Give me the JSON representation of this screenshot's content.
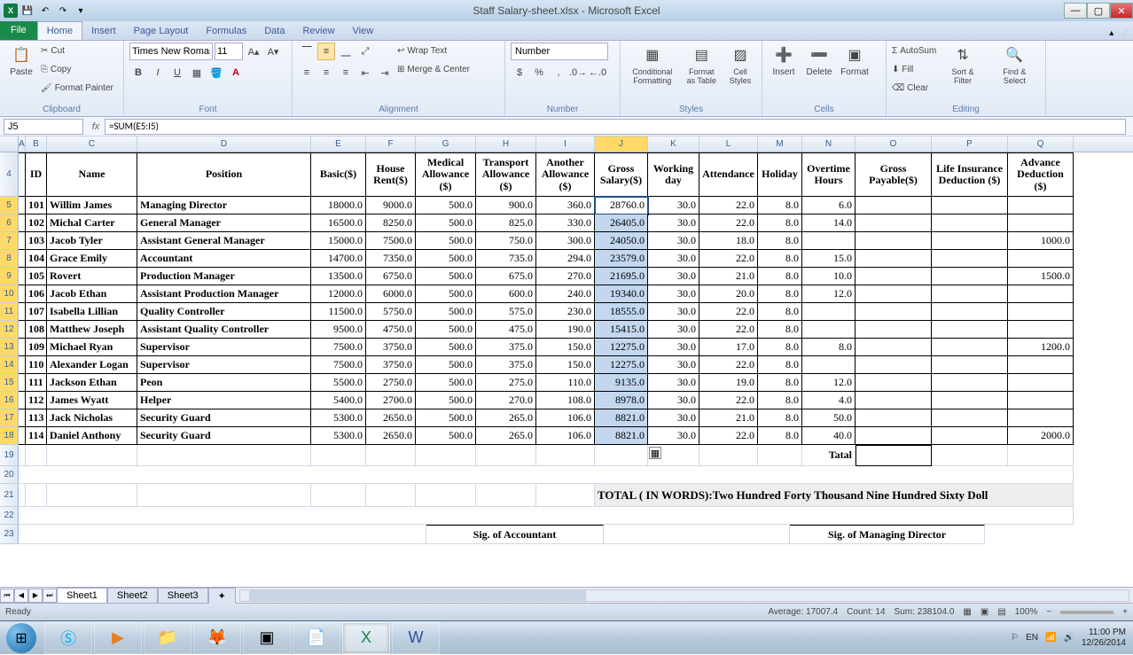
{
  "title_bar": {
    "title": "Staff  Salary-sheet.xlsx - Microsoft Excel"
  },
  "tabs": {
    "file": "File",
    "items": [
      "Home",
      "Insert",
      "Page Layout",
      "Formulas",
      "Data",
      "Review",
      "View"
    ],
    "active": "Home"
  },
  "ribbon": {
    "clipboard": {
      "label": "Clipboard",
      "paste": "Paste",
      "cut": "Cut",
      "copy": "Copy",
      "format_painter": "Format Painter"
    },
    "font": {
      "label": "Font",
      "name": "Times New Roman",
      "size": "11"
    },
    "alignment": {
      "label": "Alignment",
      "wrap": "Wrap Text",
      "merge": "Merge & Center"
    },
    "number": {
      "label": "Number",
      "format": "Number"
    },
    "styles": {
      "label": "Styles",
      "cond": "Conditional Formatting",
      "table": "Format as Table",
      "cell": "Cell Styles"
    },
    "cells": {
      "label": "Cells",
      "insert": "Insert",
      "delete": "Delete",
      "format": "Format"
    },
    "editing": {
      "label": "Editing",
      "autosum": "AutoSum",
      "fill": "Fill",
      "clear": "Clear",
      "sort": "Sort & Filter",
      "find": "Find & Select"
    }
  },
  "namebox": "J5",
  "formula": "=SUM(E5:I5)",
  "chart_data": {
    "type": "table",
    "columns": [
      "A",
      "B",
      "C",
      "D",
      "E",
      "F",
      "G",
      "H",
      "I",
      "J",
      "K",
      "L",
      "M",
      "N",
      "O",
      "P",
      "Q"
    ],
    "headers": [
      "",
      "ID",
      "Name",
      "Position",
      "Basic($)",
      "House Rent($)",
      "Medical Allowance ($)",
      "Transport Allowance ($)",
      "Another Allowance ($)",
      "Gross Salary($)",
      "Working day",
      "Attendance",
      "Holiday",
      "Overtime Hours",
      "Gross Payable($)",
      "Life Insurance Deduction ($)",
      "Advance Deduction ($)"
    ],
    "rows": [
      {
        "r": 5,
        "id": "101",
        "name": "Willim James",
        "pos": "Managing Director",
        "basic": "18000.0",
        "rent": "9000.0",
        "med": "500.0",
        "trn": "900.0",
        "ano": "360.0",
        "gross": "28760.0",
        "wd": "30.0",
        "att": "22.0",
        "hol": "8.0",
        "ot": "6.0",
        "gp": "",
        "life": "",
        "adv": ""
      },
      {
        "r": 6,
        "id": "102",
        "name": "Michal Carter",
        "pos": "General Manager",
        "basic": "16500.0",
        "rent": "8250.0",
        "med": "500.0",
        "trn": "825.0",
        "ano": "330.0",
        "gross": "26405.0",
        "wd": "30.0",
        "att": "22.0",
        "hol": "8.0",
        "ot": "14.0",
        "gp": "",
        "life": "",
        "adv": ""
      },
      {
        "r": 7,
        "id": "103",
        "name": "Jacob Tyler",
        "pos": "Assistant General Manager",
        "basic": "15000.0",
        "rent": "7500.0",
        "med": "500.0",
        "trn": "750.0",
        "ano": "300.0",
        "gross": "24050.0",
        "wd": "30.0",
        "att": "18.0",
        "hol": "8.0",
        "ot": "",
        "gp": "",
        "life": "",
        "adv": "1000.0"
      },
      {
        "r": 8,
        "id": "104",
        "name": "Grace Emily",
        "pos": "Accountant",
        "basic": "14700.0",
        "rent": "7350.0",
        "med": "500.0",
        "trn": "735.0",
        "ano": "294.0",
        "gross": "23579.0",
        "wd": "30.0",
        "att": "22.0",
        "hol": "8.0",
        "ot": "15.0",
        "gp": "",
        "life": "",
        "adv": ""
      },
      {
        "r": 9,
        "id": "105",
        "name": "Rovert",
        "pos": "Production Manager",
        "basic": "13500.0",
        "rent": "6750.0",
        "med": "500.0",
        "trn": "675.0",
        "ano": "270.0",
        "gross": "21695.0",
        "wd": "30.0",
        "att": "21.0",
        "hol": "8.0",
        "ot": "10.0",
        "gp": "",
        "life": "",
        "adv": "1500.0"
      },
      {
        "r": 10,
        "id": "106",
        "name": "Jacob Ethan",
        "pos": "Assistant Production Manager",
        "basic": "12000.0",
        "rent": "6000.0",
        "med": "500.0",
        "trn": "600.0",
        "ano": "240.0",
        "gross": "19340.0",
        "wd": "30.0",
        "att": "20.0",
        "hol": "8.0",
        "ot": "12.0",
        "gp": "",
        "life": "",
        "adv": ""
      },
      {
        "r": 11,
        "id": "107",
        "name": "Isabella Lillian",
        "pos": "Quality Controller",
        "basic": "11500.0",
        "rent": "5750.0",
        "med": "500.0",
        "trn": "575.0",
        "ano": "230.0",
        "gross": "18555.0",
        "wd": "30.0",
        "att": "22.0",
        "hol": "8.0",
        "ot": "",
        "gp": "",
        "life": "",
        "adv": ""
      },
      {
        "r": 12,
        "id": "108",
        "name": "Matthew Joseph",
        "pos": "Assistant Quality Controller",
        "basic": "9500.0",
        "rent": "4750.0",
        "med": "500.0",
        "trn": "475.0",
        "ano": "190.0",
        "gross": "15415.0",
        "wd": "30.0",
        "att": "22.0",
        "hol": "8.0",
        "ot": "",
        "gp": "",
        "life": "",
        "adv": ""
      },
      {
        "r": 13,
        "id": "109",
        "name": "Michael Ryan",
        "pos": "Supervisor",
        "basic": "7500.0",
        "rent": "3750.0",
        "med": "500.0",
        "trn": "375.0",
        "ano": "150.0",
        "gross": "12275.0",
        "wd": "30.0",
        "att": "17.0",
        "hol": "8.0",
        "ot": "8.0",
        "gp": "",
        "life": "",
        "adv": "1200.0"
      },
      {
        "r": 14,
        "id": "110",
        "name": "Alexander Logan",
        "pos": "Supervisor",
        "basic": "7500.0",
        "rent": "3750.0",
        "med": "500.0",
        "trn": "375.0",
        "ano": "150.0",
        "gross": "12275.0",
        "wd": "30.0",
        "att": "22.0",
        "hol": "8.0",
        "ot": "",
        "gp": "",
        "life": "",
        "adv": ""
      },
      {
        "r": 15,
        "id": "111",
        "name": "Jackson Ethan",
        "pos": "Peon",
        "basic": "5500.0",
        "rent": "2750.0",
        "med": "500.0",
        "trn": "275.0",
        "ano": "110.0",
        "gross": "9135.0",
        "wd": "30.0",
        "att": "19.0",
        "hol": "8.0",
        "ot": "12.0",
        "gp": "",
        "life": "",
        "adv": ""
      },
      {
        "r": 16,
        "id": "112",
        "name": "James Wyatt",
        "pos": "Helper",
        "basic": "5400.0",
        "rent": "2700.0",
        "med": "500.0",
        "trn": "270.0",
        "ano": "108.0",
        "gross": "8978.0",
        "wd": "30.0",
        "att": "22.0",
        "hol": "8.0",
        "ot": "4.0",
        "gp": "",
        "life": "",
        "adv": ""
      },
      {
        "r": 17,
        "id": "113",
        "name": "Jack Nicholas",
        "pos": "Security Guard",
        "basic": "5300.0",
        "rent": "2650.0",
        "med": "500.0",
        "trn": "265.0",
        "ano": "106.0",
        "gross": "8821.0",
        "wd": "30.0",
        "att": "21.0",
        "hol": "8.0",
        "ot": "50.0",
        "gp": "",
        "life": "",
        "adv": ""
      },
      {
        "r": 18,
        "id": "114",
        "name": "Daniel Anthony",
        "pos": "Security Guard",
        "basic": "5300.0",
        "rent": "2650.0",
        "med": "500.0",
        "trn": "265.0",
        "ano": "106.0",
        "gross": "8821.0",
        "wd": "30.0",
        "att": "22.0",
        "hol": "8.0",
        "ot": "40.0",
        "gp": "",
        "life": "",
        "adv": "2000.0"
      }
    ],
    "total_label": "Tatal",
    "total_words": "TOTAL ( IN WORDS):Two Hundred Forty Thousand Nine Hundred Sixty  Doll",
    "sig_accountant": "Sig. of Accountant",
    "sig_md": "Sig. of Managing Director"
  },
  "sheets": {
    "active": "Sheet1",
    "tabs": [
      "Sheet1",
      "Sheet2",
      "Sheet3"
    ]
  },
  "status": {
    "ready": "Ready",
    "average": "Average: 17007.4",
    "count": "Count: 14",
    "sum": "Sum: 238104.0",
    "zoom": "100%"
  },
  "taskbar": {
    "lang": "EN",
    "time": "11:00 PM",
    "date": "12/26/2014"
  }
}
